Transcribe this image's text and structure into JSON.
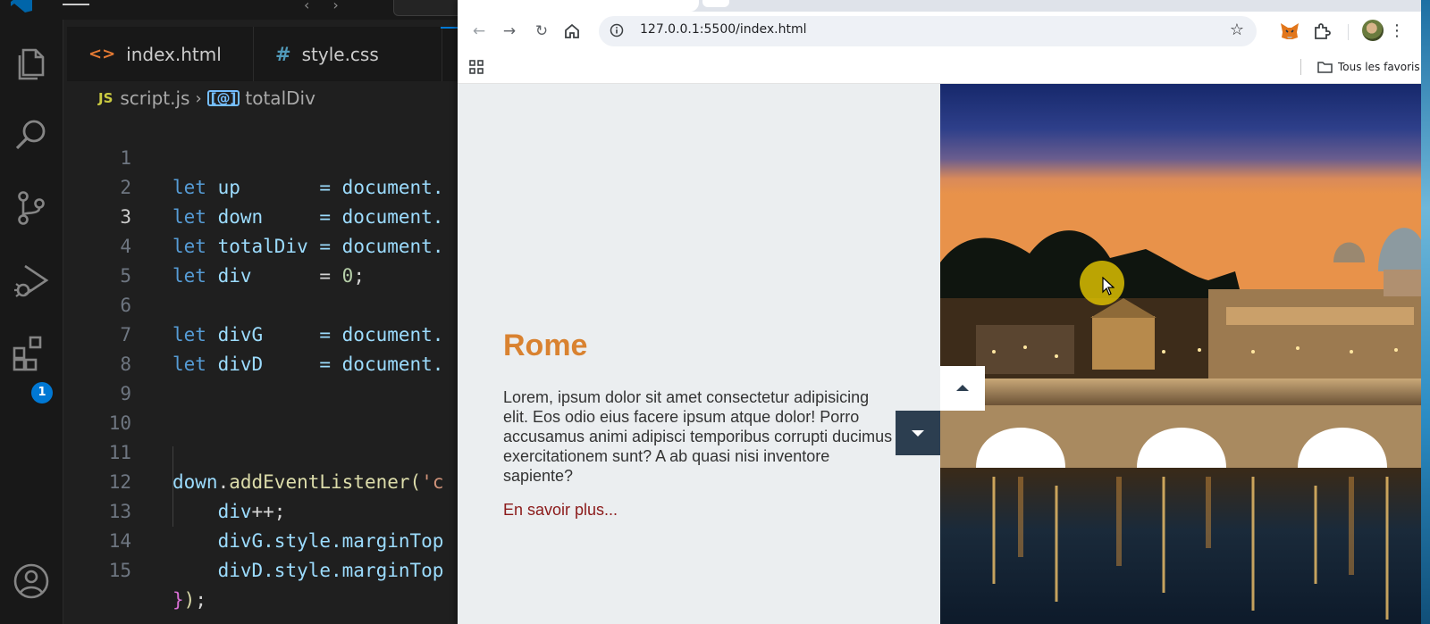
{
  "vscode": {
    "badge_count": "1",
    "tabs": [
      {
        "icon": "<>",
        "label": "index.html"
      },
      {
        "icon": "#",
        "label": "style.css"
      }
    ],
    "breadcrumb": {
      "file_icon": "JS",
      "file": "script.js",
      "symbol": "totalDiv"
    },
    "lines": [
      {
        "num": "1",
        "kw": "let ",
        "name": "up",
        "pad": "       ",
        "rest": "= document."
      },
      {
        "num": "2",
        "kw": "let ",
        "name": "down",
        "pad": "     ",
        "rest": "= document."
      },
      {
        "num": "3",
        "kw": "let ",
        "name": "totalDiv",
        "pad": " ",
        "rest": "= document."
      },
      {
        "num": "4",
        "kw": "let ",
        "name": "div",
        "pad": "      ",
        "op": "= ",
        "val": "0",
        "end": ";"
      },
      {
        "num": "5"
      },
      {
        "num": "6",
        "kw": "let ",
        "name": "divG",
        "pad": "     ",
        "rest": "= document."
      },
      {
        "num": "7",
        "kw": "let ",
        "name": "divD",
        "pad": "     ",
        "rest": "= document."
      },
      {
        "num": "8"
      },
      {
        "num": "9"
      },
      {
        "num": "10"
      },
      {
        "num": "11",
        "obj": "down",
        "dot": ".",
        "fn": "addEventListener",
        "paren": "(",
        "str": "'c"
      },
      {
        "num": "12",
        "indent": "    ",
        "obj": "div",
        "rest": "++;"
      },
      {
        "num": "13",
        "indent": "    ",
        "obj": "divG",
        "rest": ".style.marginTop"
      },
      {
        "num": "14",
        "indent": "    ",
        "obj": "divD",
        "rest": ".style.marginTop"
      },
      {
        "num": "15",
        "close_brace": "}",
        "close_paren": ")",
        "end": ";"
      }
    ],
    "current_line": "3"
  },
  "browser": {
    "url": "127.0.0.1:5500/index.html",
    "bookmarks_folder": "Tous les favoris"
  },
  "page": {
    "title": "Rome",
    "text": "Lorem, ipsum dolor sit amet consectetur adipisicing elit. Eos odio eius facere ipsum atque dolor! Porro accusamus animi adipisci temporibus corrupti ducimus exercitationem sunt? A ab quasi nisi inventore sapiente?",
    "link": "En savoir plus..."
  },
  "colors": {
    "title_orange": "#d98230",
    "link_red": "#8b1a1a",
    "down_button": "#2c3e50",
    "left_panel_bg": "#ebeef0"
  }
}
